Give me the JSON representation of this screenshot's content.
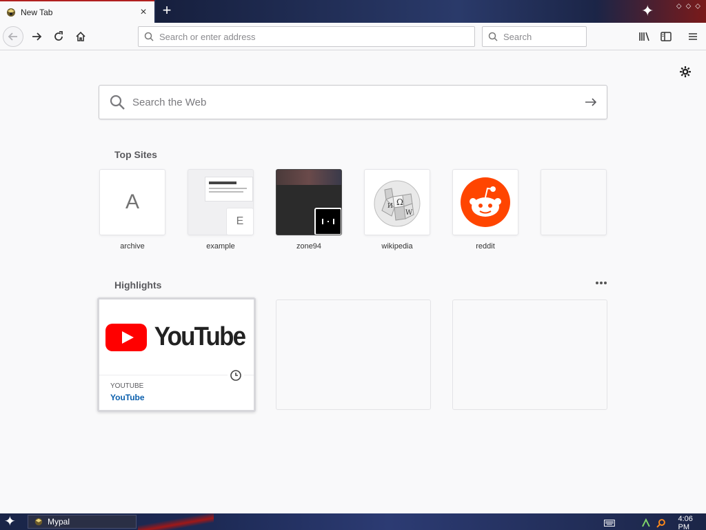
{
  "tab": {
    "title": "New Tab",
    "close_glyph": "×"
  },
  "toolbar": {
    "new_tab_glyph": "+"
  },
  "window": {
    "ctrl_min": "⬦",
    "ctrl_max": "⬦",
    "ctrl_close": "⬦"
  },
  "navbar": {
    "url_placeholder": "Search or enter address",
    "search_placeholder": "Search"
  },
  "newtab": {
    "web_search_placeholder": "Search the Web",
    "top_sites_heading": "Top Sites",
    "highlights_heading": "Highlights",
    "top_sites": [
      {
        "label": "archive",
        "letter": "A"
      },
      {
        "label": "example",
        "letter": "E"
      },
      {
        "label": "zone94"
      },
      {
        "label": "wikipedia"
      },
      {
        "label": "reddit"
      },
      {
        "label": ""
      }
    ],
    "highlights": [
      {
        "source": "YOUTUBE",
        "title": "YouTube",
        "logo_text": "YouTube"
      }
    ]
  },
  "taskbar": {
    "task_label": "Mypal",
    "time": "4:06 PM"
  },
  "colors": {
    "accent_red": "#b1201f",
    "link_blue": "#0a5fad",
    "reddit_orange": "#ff4500",
    "youtube_red": "#ff0000"
  },
  "icons": [
    "back-arrow-icon",
    "forward-arrow-icon",
    "reload-icon",
    "home-icon",
    "search-icon",
    "library-icon",
    "sidebar-icon",
    "hamburger-menu-icon",
    "gear-icon",
    "clock-icon"
  ]
}
